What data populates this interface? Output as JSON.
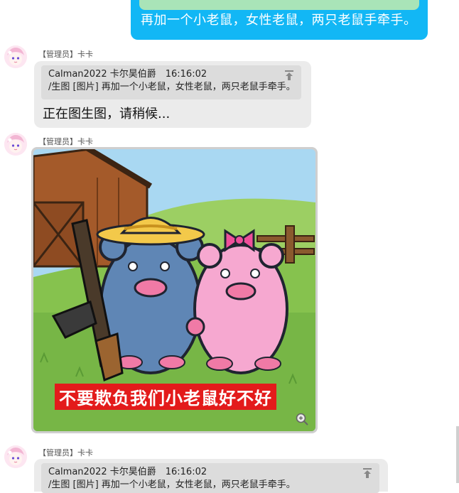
{
  "own_message": {
    "text": "再加一个小老鼠，女性老鼠，两只老鼠手牵手。"
  },
  "messages": [
    {
      "sender": "【管理员】卡卡",
      "quote": {
        "header": "Calman2022 卡尔昊伯爵　16:16:02",
        "body": "/生图 [图片] 再加一个小老鼠，女性老鼠，两只老鼠手牵手。"
      },
      "reply": "正在图生图，请稍候..."
    },
    {
      "sender": "【管理员】卡卡",
      "image": {
        "caption": "不要欺负我们小老鼠好不好"
      }
    },
    {
      "sender": "【管理员】卡卡",
      "quote": {
        "header": "Calman2022 卡尔昊伯爵　16:16:02",
        "body": "/生图 [图片] 再加一个小老鼠，女性老鼠，两只老鼠手牵手。"
      }
    }
  ],
  "icons": {
    "avatar": "anime-avatar-icon",
    "pin": "pin-top-icon",
    "zoom": "zoom-in-icon"
  },
  "colors": {
    "own_bubble": "#12b7f5",
    "other_bubble": "#ebebeb",
    "caption_bg": "#e31b1b"
  }
}
